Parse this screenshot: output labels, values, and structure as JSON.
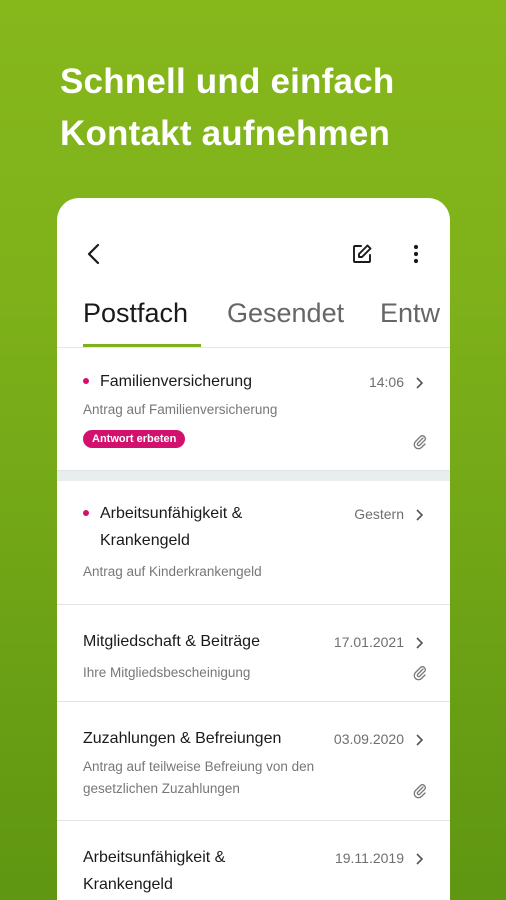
{
  "headline": {
    "line1": "Schnell und einfach",
    "line2": "Kontakt aufnehmen"
  },
  "appbar": {
    "back_icon": "arrow-left-icon",
    "edit_icon": "compose-icon",
    "more_icon": "more-vertical-icon"
  },
  "tabs": [
    {
      "label": "Postfach",
      "active": true
    },
    {
      "label": "Gesendet",
      "active": false
    },
    {
      "label": "Entw",
      "active": false
    }
  ],
  "messages": [
    {
      "title_lines": [
        "Familienversicherung"
      ],
      "date": "14:06",
      "subtitle_lines": [
        "Antrag auf Familienversicherung"
      ],
      "badge": "Antwort erbeten",
      "unread": true,
      "attachment": true
    },
    {
      "title_lines": [
        "Arbeitsunfähigkeit &",
        "Krankengeld"
      ],
      "date": "Gestern",
      "subtitle_lines": [
        "Antrag auf Kinderkrankengeld"
      ],
      "unread": true,
      "attachment": false
    },
    {
      "title_lines": [
        "Mitgliedschaft & Beiträge"
      ],
      "date": "17.01.2021",
      "subtitle_lines": [
        "Ihre Mitgliedsbescheinigung"
      ],
      "unread": false,
      "attachment": true
    },
    {
      "title_lines": [
        "Zuzahlungen & Befreiungen"
      ],
      "date": "03.09.2020",
      "subtitle_lines": [
        "Antrag auf teilweise Befreiung von den",
        "gesetzlichen Zuzahlungen"
      ],
      "unread": false,
      "attachment": true
    },
    {
      "title_lines": [
        "Arbeitsunfähigkeit &",
        "Krankengeld"
      ],
      "date": "19.11.2019",
      "subtitle_lines": [],
      "unread": false,
      "attachment": false
    }
  ],
  "colors": {
    "accent_green": "#7eb11c",
    "unread_magenta": "#d2116f"
  }
}
